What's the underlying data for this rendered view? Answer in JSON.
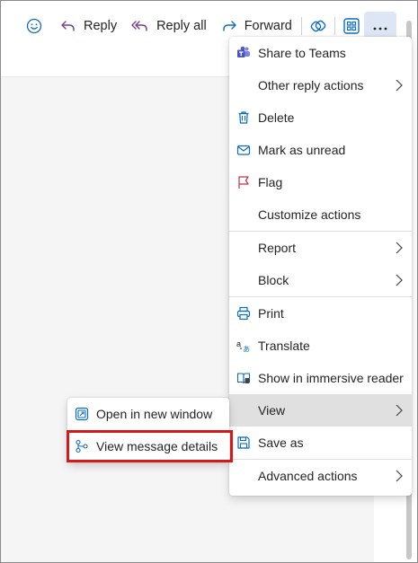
{
  "toolbar": {
    "emoji_icon": "smiley-icon",
    "reply_label": "Reply",
    "reply_all_label": "Reply all",
    "forward_label": "Forward",
    "more_icon": "more-dots-icon"
  },
  "main_menu": {
    "items": [
      {
        "label": "Share to Teams",
        "icon": "teams-icon"
      },
      {
        "label": "Other reply actions",
        "icon": "",
        "submenu": true
      },
      {
        "label": "Delete",
        "icon": "trash-icon"
      },
      {
        "label": "Mark as unread",
        "icon": "envelope-icon"
      },
      {
        "label": "Flag",
        "icon": "flag-icon"
      },
      {
        "label": "Customize actions",
        "icon": ""
      },
      {
        "label": "Report",
        "icon": "",
        "submenu": true
      },
      {
        "label": "Block",
        "icon": "",
        "submenu": true
      },
      {
        "label": "Print",
        "icon": "printer-icon"
      },
      {
        "label": "Translate",
        "icon": "translate-icon"
      },
      {
        "label": "Show in immersive reader",
        "icon": "immersive-reader-icon"
      },
      {
        "label": "View",
        "icon": "",
        "submenu": true,
        "active": true
      },
      {
        "label": "Save as",
        "icon": "save-icon"
      },
      {
        "label": "Advanced actions",
        "icon": "",
        "submenu": true
      }
    ]
  },
  "view_submenu": {
    "items": [
      {
        "label": "Open in new window",
        "icon": "open-window-icon"
      },
      {
        "label": "View message details",
        "icon": "message-details-icon",
        "highlighted": true
      }
    ]
  },
  "colors": {
    "accent": "#0f6cbd",
    "reply_purple": "#7a3f8e",
    "highlight_red": "#d21a1a",
    "active_item": "#e0e0e0",
    "more_button_bg": "#dde6f4"
  }
}
